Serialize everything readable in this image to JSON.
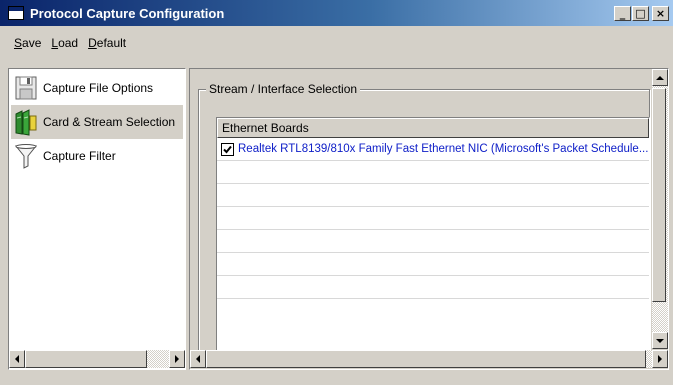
{
  "window": {
    "title": "Protocol Capture Configuration",
    "minimize_glyph": "_",
    "maximize_glyph": "□",
    "close_glyph": "×"
  },
  "menu": [
    {
      "accel": "S",
      "rest": "ave"
    },
    {
      "accel": "L",
      "rest": "oad"
    },
    {
      "accel": "D",
      "rest": "efault"
    }
  ],
  "sidebar": {
    "items": [
      {
        "label": "Capture File Options",
        "icon": "floppy-disk-icon",
        "selected": false
      },
      {
        "label": "Card & Stream Selection",
        "icon": "network-card-icon",
        "selected": true
      },
      {
        "label": "Capture Filter",
        "icon": "funnel-filter-icon",
        "selected": false
      }
    ]
  },
  "main": {
    "group_title": "Stream / Interface Selection",
    "list": {
      "column_header": "Ethernet Boards",
      "rows": [
        {
          "checked": true,
          "text": "Realtek RTL8139/810x Family Fast Ethernet NIC (Microsoft's Packet Schedule..."
        }
      ],
      "empty_rows": 6
    }
  },
  "colors": {
    "titlebar_start": "#0a246a",
    "titlebar_end": "#a6caf0",
    "window_bg": "#d4d0c8",
    "link_text": "#1020c8"
  }
}
